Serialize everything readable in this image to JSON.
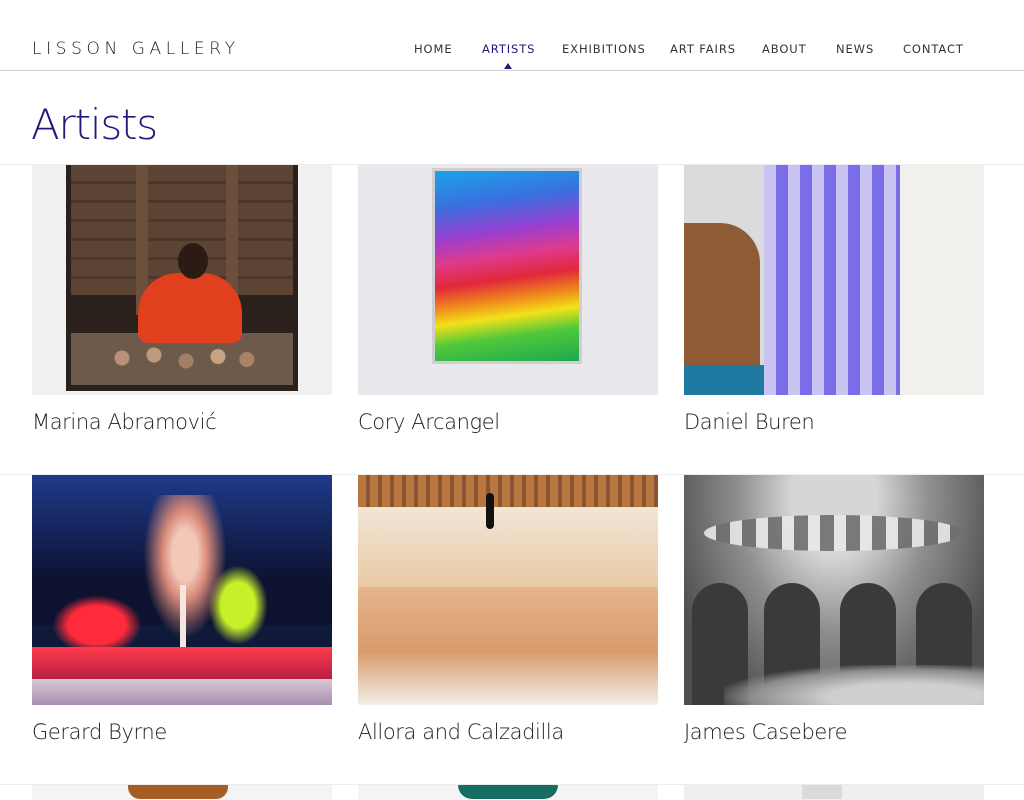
{
  "header": {
    "logo": "LISSON GALLERY",
    "nav": [
      {
        "label": "HOME",
        "active": false
      },
      {
        "label": "ARTISTS",
        "active": true
      },
      {
        "label": "EXHIBITIONS",
        "active": false
      },
      {
        "label": "ART FAIRS",
        "active": false
      },
      {
        "label": "ABOUT",
        "active": false
      },
      {
        "label": "NEWS",
        "active": false
      },
      {
        "label": "CONTACT",
        "active": false
      }
    ]
  },
  "page": {
    "title": "Artists"
  },
  "colors": {
    "accent": "#1f1a7a",
    "text": "#1d1d1d",
    "rule": "#ececec"
  },
  "artists": [
    {
      "name": "Marina Abramović",
      "thumb": "abramovic-artwork-image"
    },
    {
      "name": "Cory Arcangel",
      "thumb": "arcangel-artwork-image"
    },
    {
      "name": "Daniel Buren",
      "thumb": "buren-artwork-image"
    },
    {
      "name": "Gerard Byrne",
      "thumb": "byrne-artwork-image"
    },
    {
      "name": "Allora and Calzadilla",
      "thumb": "allora-calzadilla-artwork-image"
    },
    {
      "name": "James Casebere",
      "thumb": "casebere-artwork-image"
    },
    {
      "name": "",
      "thumb": "partial-artwork-image"
    },
    {
      "name": "",
      "thumb": "partial-artwork-image"
    },
    {
      "name": "",
      "thumb": "partial-artwork-image"
    }
  ]
}
